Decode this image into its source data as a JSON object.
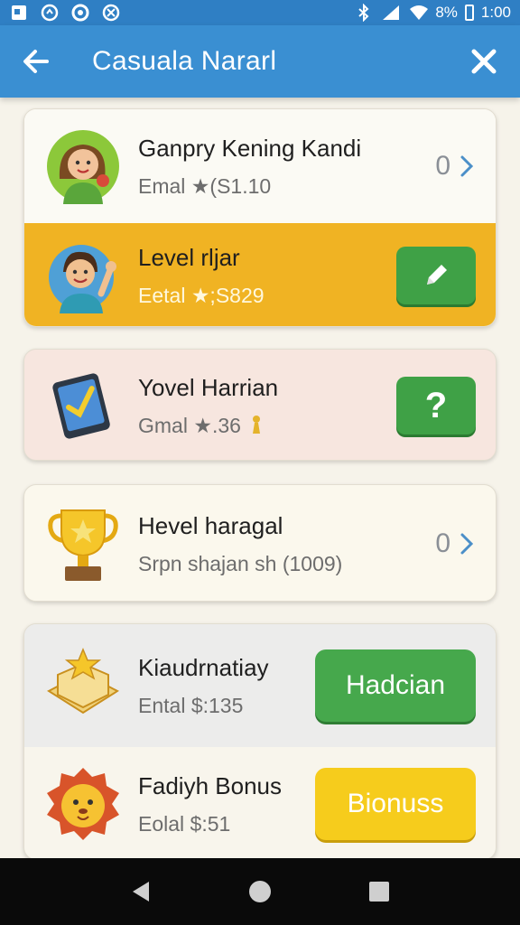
{
  "status_bar": {
    "time": "1:00",
    "battery": "8%"
  },
  "header": {
    "title": "Casuala Nararl"
  },
  "items": [
    {
      "title": "Ganpry Kening Kandi",
      "subtitle": "Emal ★(S1.10",
      "count": "0"
    },
    {
      "title": "Level rljar",
      "subtitle": "Eetal ★;S829",
      "action": "edit"
    },
    {
      "title": "Yovel Harrian",
      "subtitle": "Gmal ★.36",
      "action": "?"
    },
    {
      "title": "Hevel haragal",
      "subtitle": "Srpn shajan sh (1009)",
      "count": "0"
    },
    {
      "title": "Kiaudrnatiay",
      "subtitle": "Ental $:135",
      "button": "Hadcian"
    },
    {
      "title": "Fadiyh Bonus",
      "subtitle": "Eolal $:51",
      "button": "Bionuss"
    }
  ],
  "colors": {
    "app_bar": "#3a8fd2",
    "highlight": "#f0b323",
    "green": "#46a84c",
    "yellow": "#f6cc1c"
  },
  "icons": [
    "back-arrow-icon",
    "close-icon",
    "chevron-right-icon",
    "pencil-icon",
    "trophy-icon",
    "gift-box-icon",
    "lion-icon",
    "tablet-check-icon"
  ]
}
